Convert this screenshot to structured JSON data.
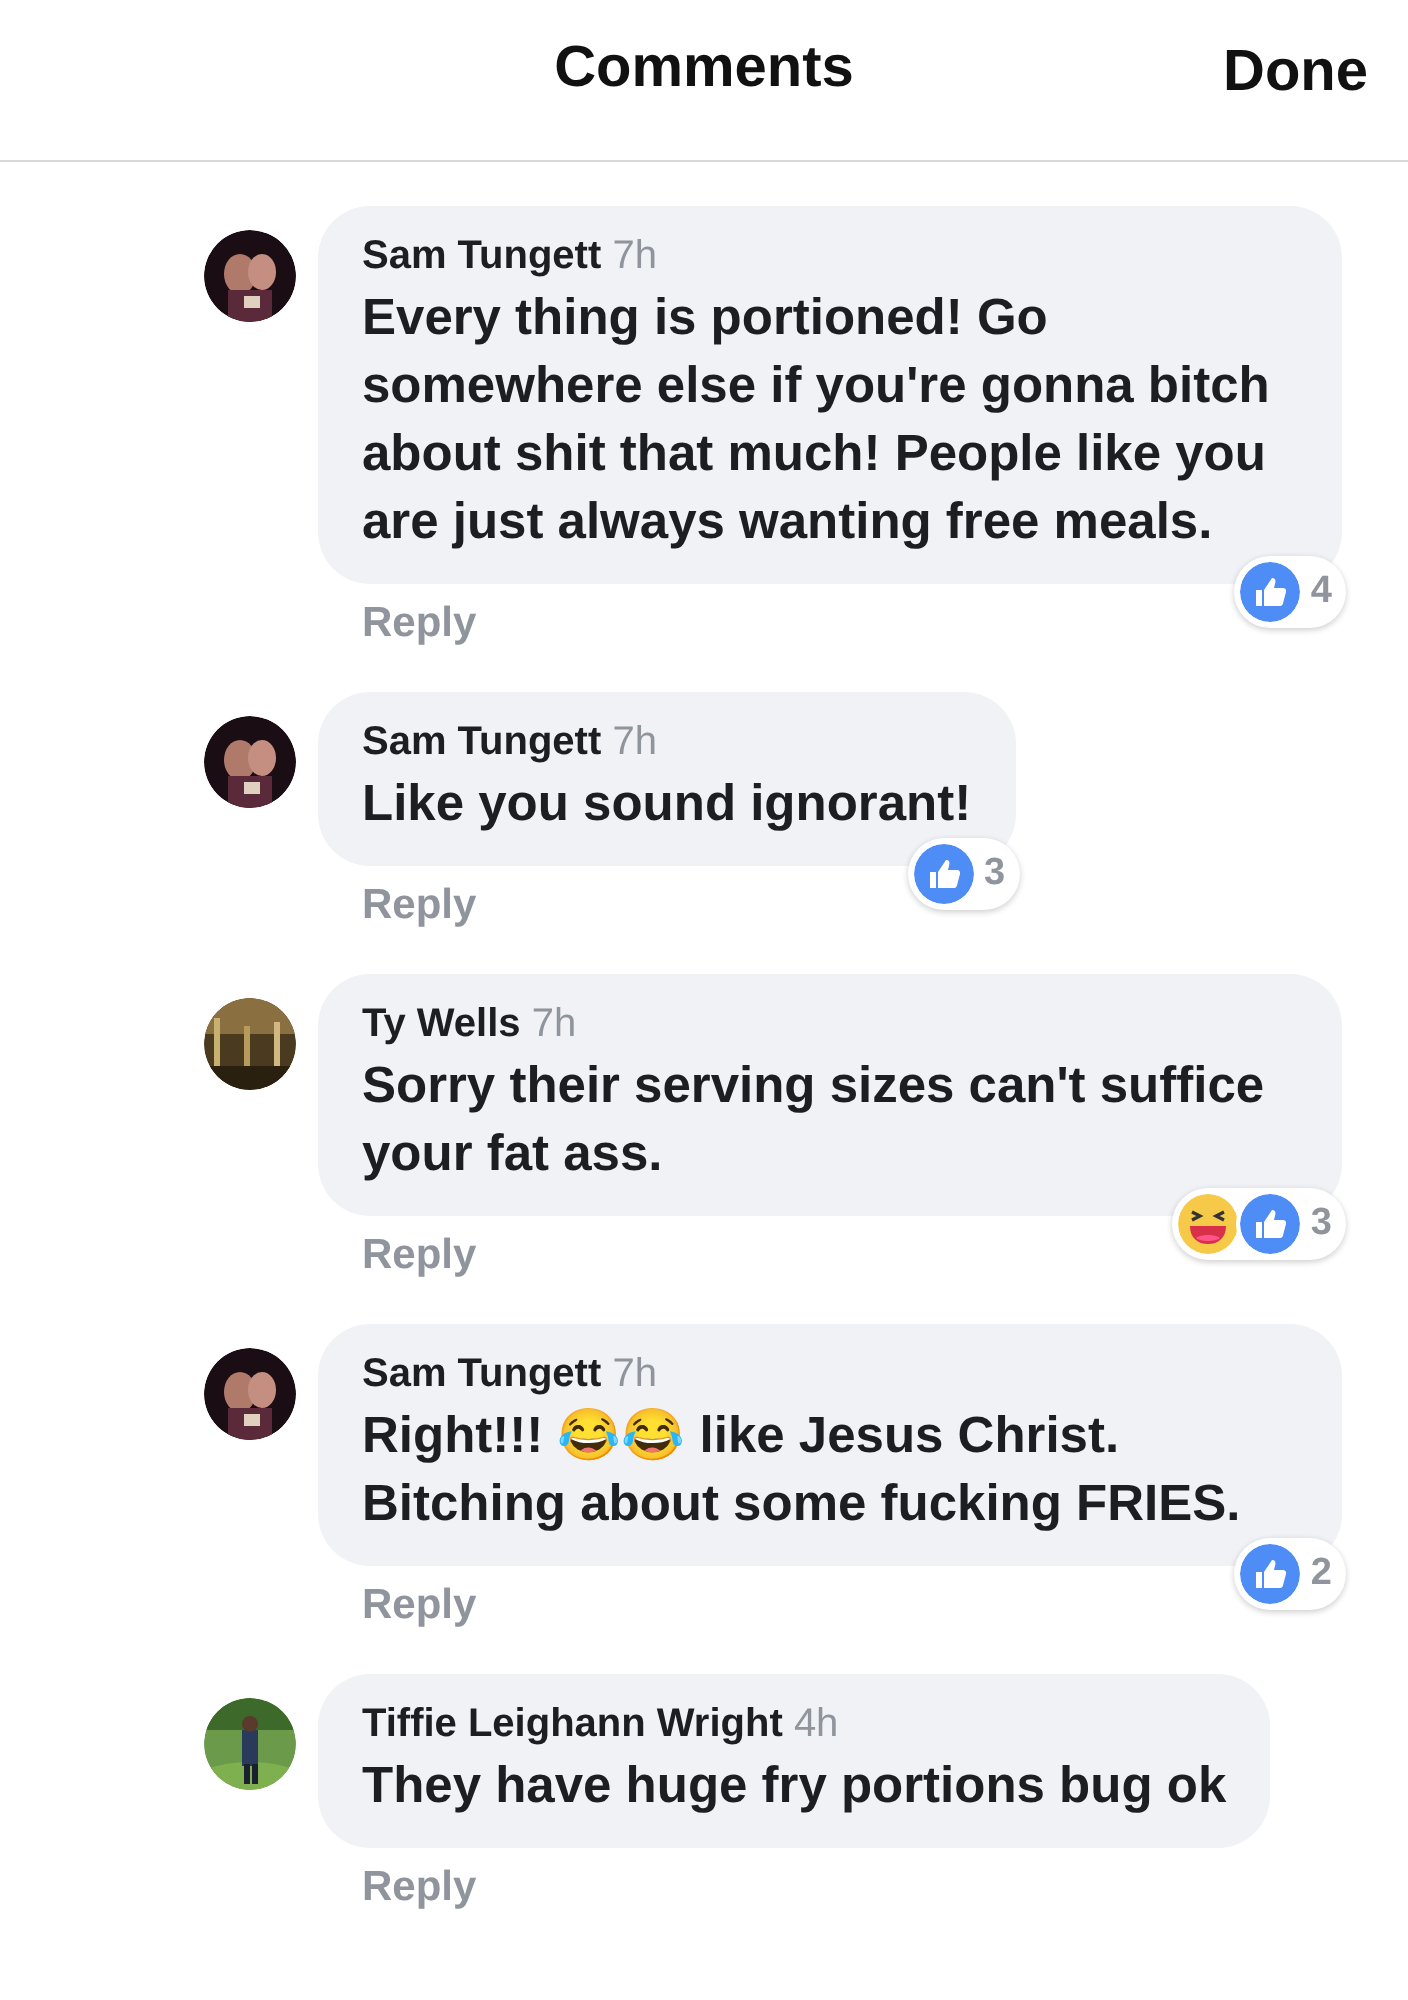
{
  "header": {
    "title": "Comments",
    "done": "Done"
  },
  "comments": [
    {
      "name": "Sam Tungett",
      "time": "7h",
      "text": "Every thing is portioned! Go somewhere else if you're gonna bitch about shit that much! People like you are just always wanting free meals.",
      "reactions": [
        {
          "kind": "like"
        }
      ],
      "count": "4",
      "reply": "Reply"
    },
    {
      "name": "Sam Tungett",
      "time": "7h",
      "text": "Like you sound ignorant!",
      "reactions": [
        {
          "kind": "like"
        }
      ],
      "count": "3",
      "reply": "Reply"
    },
    {
      "name": "Ty Wells",
      "time": "7h",
      "text": "Sorry their serving sizes can't suffice your fat ass.",
      "reactions": [
        {
          "kind": "haha"
        },
        {
          "kind": "like"
        }
      ],
      "count": "3",
      "reply": "Reply"
    },
    {
      "name": "Sam Tungett",
      "time": "7h",
      "text": "Right!!! 😂😂 like Jesus Christ. Bitching about some fucking FRIES.",
      "reactions": [
        {
          "kind": "like"
        }
      ],
      "count": "2",
      "reply": "Reply"
    },
    {
      "name": "Tiffie Leighann Wright",
      "time": "4h",
      "text": "They have huge fry portions bug ok",
      "reply": "Reply"
    }
  ]
}
